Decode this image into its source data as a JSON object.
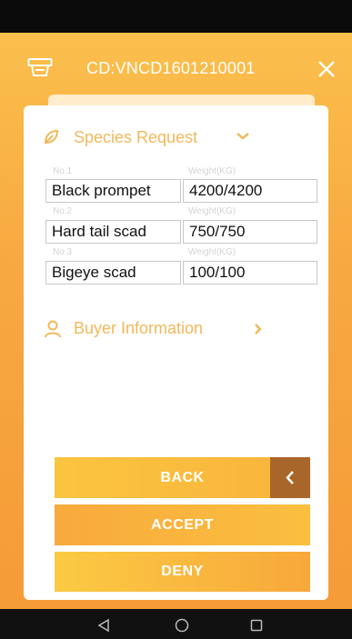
{
  "header": {
    "title": "CD:VNCD1601210001",
    "cart_icon": "cart-icon",
    "close_icon": "close-icon"
  },
  "species_section": {
    "title": "Species Request",
    "icon": "leaf-icon",
    "items": [
      {
        "number": "No.1",
        "weight_caption": "Weight(KG)",
        "name": "Black prompet",
        "weight": "4200/4200"
      },
      {
        "number": "No.2",
        "weight_caption": "Weight(KG)",
        "name": "Hard tail scad",
        "weight": "750/750"
      },
      {
        "number": "No.3",
        "weight_caption": "Weight(KG)",
        "name": "Bigeye scad",
        "weight": "100/100"
      }
    ]
  },
  "buyer_section": {
    "title": "Buyer Information",
    "icon": "person-icon"
  },
  "buttons": {
    "back": "BACK",
    "accept": "ACCEPT",
    "deny": "DENY"
  },
  "colors": {
    "accent": "#f7a941",
    "section_text": "#f2b85c",
    "back_tab": "#a9662a"
  }
}
